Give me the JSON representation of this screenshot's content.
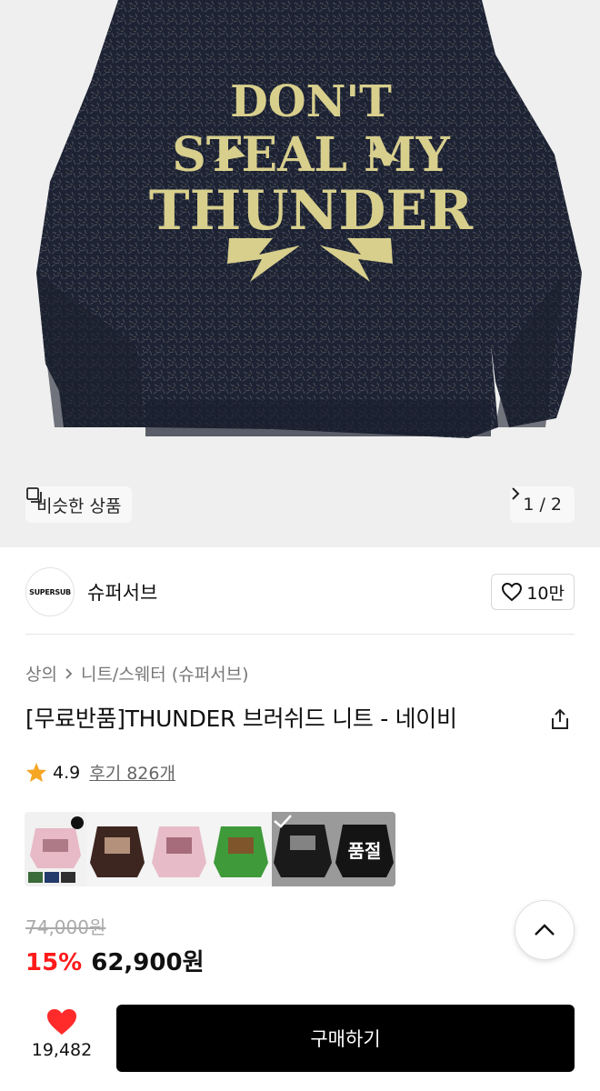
{
  "hero": {
    "graphic_text_lines": [
      "DON'T",
      "STEAL MY",
      "THUNDER"
    ],
    "similar_label": "비슷한 상품",
    "pager_text": "1 / 2"
  },
  "brand": {
    "logo_text": "SUPERSUB",
    "name": "슈퍼서브",
    "like_count": "10만"
  },
  "breadcrumb": {
    "level1": "상의",
    "level2": "니트/스웨터 (슈퍼서브)"
  },
  "product": {
    "title": "[무료반품]THUNDER 브러쉬드 니트 - 네이비",
    "rating": "4.9",
    "reviews": "후기 826개"
  },
  "swatches": {
    "soldout_label": "품절",
    "items": [
      {
        "color": "#e8b9c6",
        "graphic": "#a06a78"
      },
      {
        "color": "#3d2620",
        "graphic": "#c8a48c"
      },
      {
        "color": "#e7bcc8",
        "graphic": "#9a5e6f"
      },
      {
        "color": "#3f9a3a",
        "graphic": "#8b4a2a"
      },
      {
        "color": "#1a1a1a",
        "graphic": "#c9c9c9"
      },
      {
        "color": "#141414",
        "graphic": "#e0e0e0"
      }
    ]
  },
  "price": {
    "original": "74,000원",
    "discount": "15%",
    "sale": "62,900원"
  },
  "bottom": {
    "wish_count": "19,482",
    "buy_label": "구매하기"
  },
  "colors": {
    "sweater_navy": "#1d2333",
    "graphic_gold": "#d8cf8d",
    "discount_red": "#ff1a1a",
    "heart_red": "#ff2a2a"
  }
}
